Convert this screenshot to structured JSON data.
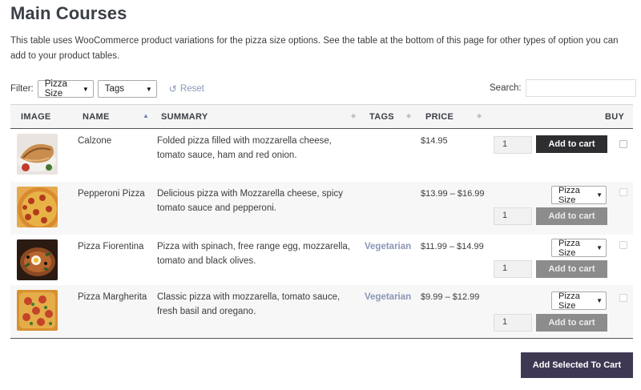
{
  "page": {
    "title": "Main Courses",
    "intro": "This table uses WooCommerce product variations for the pizza size options. See the table at the bottom of this page for other types of option you can add to your product tables."
  },
  "filters": {
    "label": "Filter:",
    "size_select": "Pizza Size",
    "tags_select": "Tags",
    "reset_label": "Reset",
    "reset_icon": "reset-icon"
  },
  "search": {
    "label": "Search:",
    "value": ""
  },
  "table": {
    "headers": {
      "image": "IMAGE",
      "name": "NAME",
      "summary": "SUMMARY",
      "tags": "TAGS",
      "price": "PRICE",
      "buy": "BUY"
    },
    "rows": [
      {
        "name": "Calzone",
        "summary": "Folded pizza filled with mozzarella cheese, tomato sauce, ham and red onion.",
        "tags": "",
        "price": "$14.95",
        "quantity": "1",
        "button": "Add to cart",
        "image_icon": "calzone-image"
      },
      {
        "name": "Pepperoni Pizza",
        "summary": "Delicious pizza with Mozzarella cheese, spicy tomato sauce and pepperoni.",
        "tags": "",
        "price": "$13.99 – $16.99",
        "variation": "Pizza Size",
        "quantity": "1",
        "button": "Add to cart",
        "image_icon": "pepperoni-pizza-image"
      },
      {
        "name": "Pizza Fiorentina",
        "summary": "Pizza with spinach, free range egg, mozzarella, tomato and black olives.",
        "tags": "Vegetarian",
        "price": "$11.99 – $14.99",
        "variation": "Pizza Size",
        "quantity": "1",
        "button": "Add to cart",
        "image_icon": "pizza-fiorentina-image"
      },
      {
        "name": "Pizza Margherita",
        "summary": "Classic pizza with mozzarella, tomato sauce, fresh basil and oregano.",
        "tags": "Vegetarian",
        "price": "$9.99 – $12.99",
        "variation": "Pizza Size",
        "quantity": "1",
        "button": "Add to cart",
        "image_icon": "pizza-margherita-image"
      }
    ]
  },
  "footer": {
    "add_selected": "Add Selected To Cart"
  },
  "colors": {
    "accent_link": "#8a96b8",
    "button_dark": "#2e2e30",
    "button_disabled": "#8c8c8c",
    "add_selected_bg": "#3f3853"
  }
}
